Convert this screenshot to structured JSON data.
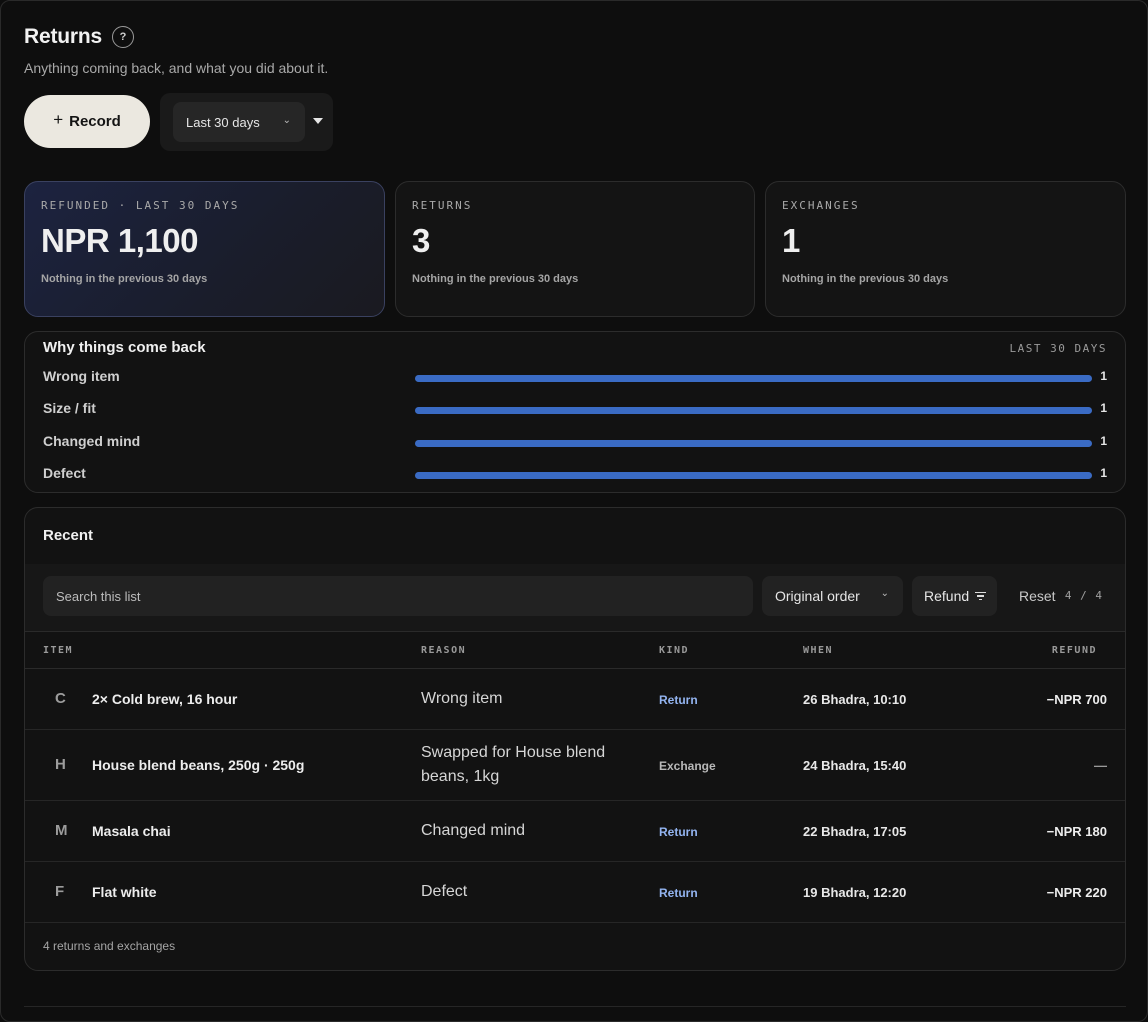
{
  "header": {
    "title": "Returns",
    "help_glyph": "?",
    "subtitle": "Anything coming back, and what you did about it."
  },
  "actions": {
    "record_icon": "plus-icon",
    "record_label": "Record",
    "range_label": "Last 30 days"
  },
  "stats": [
    {
      "label": "REFUNDED · LAST 30 DAYS",
      "value": "NPR 1,100",
      "note": "Nothing in the previous 30 days"
    },
    {
      "label": "RETURNS",
      "value": "3",
      "note": "Nothing in the previous 30 days"
    },
    {
      "label": "EXCHANGES",
      "value": "1",
      "note": "Nothing in the previous 30 days"
    }
  ],
  "reasons": {
    "title": "Why things come back",
    "range": "LAST 30 DAYS",
    "accent_color": "#3a6bc4",
    "items": [
      {
        "label": "Wrong item",
        "count": "1",
        "fraction": 1.0
      },
      {
        "label": "Size / fit",
        "count": "1",
        "fraction": 1.0
      },
      {
        "label": "Changed mind",
        "count": "1",
        "fraction": 1.0
      },
      {
        "label": "Defect",
        "count": "1",
        "fraction": 1.0
      }
    ]
  },
  "recent": {
    "title": "Recent",
    "search_placeholder": "Search this list",
    "order_label": "Original order",
    "filter_label": "Refund",
    "reset_label": "Reset",
    "page_count": "4 / 4",
    "columns": {
      "item": "ITEM",
      "reason": "REASON",
      "kind": "KIND",
      "when": "WHEN",
      "refund": "REFUND"
    },
    "rows": [
      {
        "initial": "C",
        "item": "2× Cold brew, 16 hour",
        "reason": "Wrong item",
        "kind": "Return",
        "when": "26 Bhadra, 10:10",
        "refund": "−NPR 700"
      },
      {
        "initial": "H",
        "item": "House blend beans, 250g · 250g",
        "reason": "Swapped for House blend beans, 1kg",
        "kind": "Exchange",
        "when": "24 Bhadra, 15:40",
        "refund": "—"
      },
      {
        "initial": "M",
        "item": "Masala chai",
        "reason": "Changed mind",
        "kind": "Return",
        "when": "22 Bhadra, 17:05",
        "refund": "−NPR 180"
      },
      {
        "initial": "F",
        "item": "Flat white",
        "reason": "Defect",
        "kind": "Return",
        "when": "19 Bhadra, 12:20",
        "refund": "−NPR 220"
      }
    ],
    "footer": "4 returns and exchanges"
  }
}
